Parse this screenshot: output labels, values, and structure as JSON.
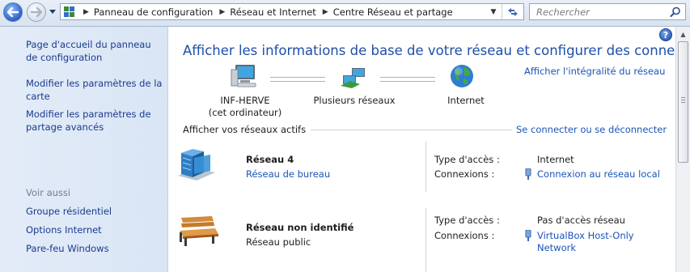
{
  "window": {
    "title": "Centre Réseau et partage"
  },
  "addressbar": {
    "breadcrumbs": [
      "Panneau de configuration",
      "Réseau et Internet",
      "Centre Réseau et partage"
    ],
    "search_placeholder": "Rechercher"
  },
  "sidebar": {
    "links": [
      "Page d'accueil du panneau de configuration",
      "Modifier les paramètres de la carte",
      "Modifier les paramètres de partage avancés"
    ],
    "see_also_title": "Voir aussi",
    "see_also": [
      "Groupe résidentiel",
      "Options Internet",
      "Pare-feu Windows"
    ]
  },
  "main": {
    "heading": "Afficher les informations de base de votre réseau et configurer des connexions",
    "view_full_map": "Afficher l'intégralité du réseau",
    "map": {
      "computer_name": "INF-HERVE",
      "computer_sub": "(cet ordinateur)",
      "networks": "Plusieurs réseaux",
      "internet": "Internet"
    },
    "active_networks_title": "Afficher vos réseaux actifs",
    "connect_disconnect": "Se connecter ou se déconnecter",
    "networks": [
      {
        "name": "Réseau  4",
        "type": "Réseau de bureau",
        "access_label": "Type d'accès :",
        "access_value": "Internet",
        "connections_label": "Connexions :",
        "connection": "Connexion au réseau local"
      },
      {
        "name": "Réseau non identifié",
        "type": "Réseau public",
        "access_label": "Type d'accès :",
        "access_value": "Pas d'accès réseau",
        "connections_label": "Connexions :",
        "connection_line1": "VirtualBox Host-Only",
        "connection_line2": "Network"
      }
    ]
  },
  "colors": {
    "link": "#1a55b8",
    "heading": "#1e4fa8",
    "sidebar_link": "#1a3a8c",
    "sidebar_bg": "#dfe9f6"
  },
  "icons": [
    "back-arrow-icon",
    "forward-arrow-icon",
    "control-panel-icon",
    "refresh-icon",
    "search-icon",
    "help-icon",
    "computer-icon",
    "networks-icon",
    "globe-icon",
    "building-icon",
    "bench-icon",
    "plug-icon"
  ]
}
